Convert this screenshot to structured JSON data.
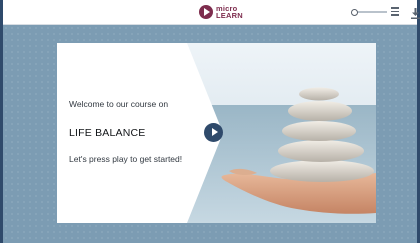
{
  "brand": {
    "logo_line1": "micro",
    "logo_line2": "LEARN",
    "logo_icon": "play-circle-icon",
    "brand_color": "#7e2d4e",
    "accent_color": "#2f4a6b"
  },
  "player": {
    "progress_fraction": 0.0,
    "menu_icon": "hamburger-menu-icon",
    "download_icon": "download-icon"
  },
  "slide": {
    "welcome_text": "Welcome to our course on",
    "course_title": "LIFE BALANCE",
    "cta_text": "Let's press play to get started!",
    "play_icon": "play-icon",
    "photo_description_icon": "stacked-stones-on-hand-photo"
  }
}
